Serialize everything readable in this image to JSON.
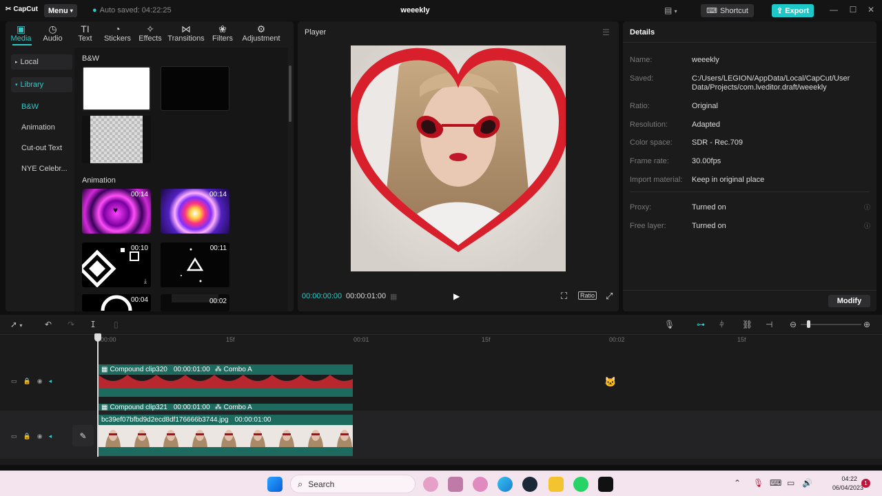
{
  "app": {
    "logo": "CapCut",
    "menu_label": "Menu",
    "autosave": "Auto saved: 04:22:25",
    "project_title": "weeekly",
    "shortcut_label": "Shortcut",
    "export_label": "Export"
  },
  "tabs": [
    {
      "label": "Media",
      "icon": "media-icon"
    },
    {
      "label": "Audio",
      "icon": "audio-icon"
    },
    {
      "label": "Text",
      "icon": "text-icon"
    },
    {
      "label": "Stickers",
      "icon": "stickers-icon"
    },
    {
      "label": "Effects",
      "icon": "effects-icon"
    },
    {
      "label": "Transitions",
      "icon": "transitions-icon"
    },
    {
      "label": "Filters",
      "icon": "filters-icon"
    },
    {
      "label": "Adjustment",
      "icon": "adjustment-icon"
    }
  ],
  "sidebar": {
    "local": "Local",
    "library": "Library",
    "items": [
      "B&W",
      "Animation",
      "Cut-out Text",
      "NYE Celebr..."
    ]
  },
  "library": {
    "bw_title": "B&W",
    "animation_title": "Animation",
    "anim_durations": [
      "00:14",
      "00:14",
      "00:10",
      "00:11",
      "00:04",
      "00:02"
    ]
  },
  "player": {
    "title": "Player",
    "time_current": "00:00:00:00",
    "time_total": "00:00:01:00",
    "ratio_label": "Ratio"
  },
  "details": {
    "title": "Details",
    "rows": [
      {
        "label": "Name:",
        "value": "weeekly"
      },
      {
        "label": "Saved:",
        "value": "C:/Users/LEGION/AppData/Local/CapCut/User Data/Projects/com.lveditor.draft/weeekly"
      },
      {
        "label": "Ratio:",
        "value": "Original"
      },
      {
        "label": "Resolution:",
        "value": "Adapted"
      },
      {
        "label": "Color space:",
        "value": "SDR - Rec.709"
      },
      {
        "label": "Frame rate:",
        "value": "30.00fps"
      },
      {
        "label": "Import material:",
        "value": "Keep in original place"
      }
    ],
    "extra": [
      {
        "label": "Proxy:",
        "value": "Turned on"
      },
      {
        "label": "Free layer:",
        "value": "Turned on"
      }
    ],
    "modify_label": "Modify"
  },
  "timeline": {
    "ruler": [
      "00:00",
      "15f",
      "00:01",
      "15f",
      "00:02",
      "15f"
    ],
    "clip1": {
      "name": "Compound clip320",
      "duration": "00:00:01:00",
      "combo": "Combo A"
    },
    "clip1b": {
      "name": "Compound clip321",
      "duration": "00:00:01:00",
      "combo": "Combo A"
    },
    "clip2": {
      "name": "bc39ef07bfbd9d2ecd8df176666b3744.jpg",
      "duration": "00:00:01:00"
    }
  },
  "taskbar": {
    "search": "Search",
    "time": "04:22",
    "date": "06/04/2023",
    "notifications": "1"
  }
}
